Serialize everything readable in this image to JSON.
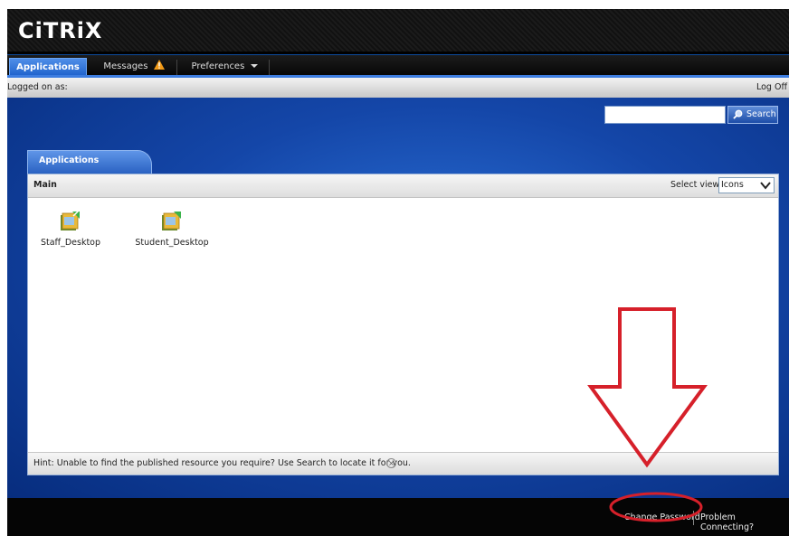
{
  "brand": {
    "logo_text": "CiTRiX"
  },
  "nav": {
    "tabs": [
      {
        "label": "Applications",
        "active": true
      },
      {
        "label": "Messages",
        "icon": "warning-icon"
      },
      {
        "label": "Preferences",
        "icon": "chevron-down-icon"
      }
    ]
  },
  "status_bar": {
    "logged_on_label": "Logged on as:",
    "log_off_label": "Log Off"
  },
  "search": {
    "value": "",
    "button_label": "Search",
    "button_icon": "search-icon"
  },
  "applications_tab": {
    "label": "Applications"
  },
  "panel": {
    "title": "Main",
    "select_view_label": "Select view:",
    "select_view_value": "Icons",
    "apps": [
      {
        "label": "Staff_Desktop",
        "icon": "desktop-app-icon"
      },
      {
        "label": "Student_Desktop",
        "icon": "desktop-app-icon"
      }
    ],
    "hint": "Hint: Unable to find the published resource you require? Use Search to locate it for you."
  },
  "footer": {
    "change_password": "Change Password",
    "problem_connecting": "Problem Connecting?"
  },
  "colors": {
    "accent_blue": "#1a5ec9",
    "annotation_red": "#d6202a",
    "warning_orange": "#f29a16"
  }
}
